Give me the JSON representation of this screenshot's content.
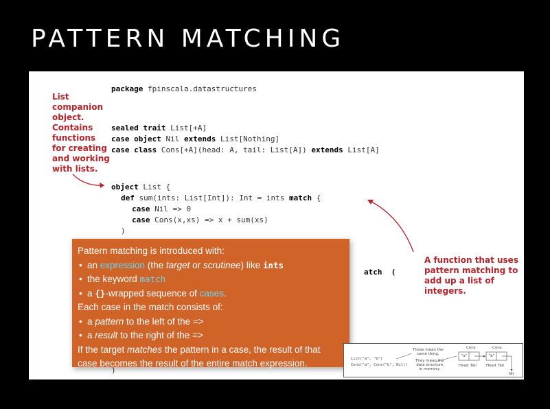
{
  "slide": {
    "title": "PATTERN MATCHING"
  },
  "code": {
    "package_kw": "package",
    "package_name": " fpinscala.datastructures",
    "sealed_kw": "sealed trait",
    "sealed_rest": " List[+A]",
    "case_object_kw": "case object",
    "nil_mid": " Nil ",
    "extends_kw": "extends",
    "nil_rest": " List[Nothing]",
    "case_class_kw": "case class",
    "cons_mid": " Cons[+A](head: A, tail: List[A]) ",
    "cons_rest": " List[A]",
    "object_kw": "object",
    "object_rest": " List {",
    "def_kw": "def",
    "def_mid": " sum(ints: List[Int]): Int = ints ",
    "match_kw": "match",
    "def_end": " {",
    "case_kw": "case",
    "case1_rest": " Nil => 0",
    "case2_rest": " Cons(x,xs) => x + sum(xs)",
    "close1": ")",
    "partial_match": "atch  (",
    "close2": ")"
  },
  "notes": {
    "companion": [
      "List",
      "companion",
      "object.",
      "Contains",
      "functions",
      "for creating",
      "and working",
      "with lists."
    ],
    "function_note": [
      "A function that uses",
      "pattern matching to",
      "add up a list of integers."
    ]
  },
  "callout": {
    "intro": "Pattern matching is introduced with:",
    "b1_a": "an ",
    "b1_expr": "expression",
    "b1_b": " (the ",
    "b1_target": "target",
    "b1_c": " or ",
    "b1_scrutinee": "scrutinee",
    "b1_d": ") like ",
    "b1_code": "ints",
    "b2_a": "the keyword ",
    "b2_code": "match",
    "b3_a": "a ",
    "b3_code": "{}",
    "b3_b": "-wrapped sequence of ",
    "b3_cases": "cases",
    "b3_c": ".",
    "each": "Each case in the match consists of:",
    "b4_a": "a ",
    "b4_pattern": "pattern",
    "b4_b": " to the left of the =>",
    "b5_a": "a ",
    "b5_result": "result",
    "b5_b": " to the right of the =>",
    "final1_a": "If the target ",
    "final1_matches": "matches",
    "final1_b": " the pattern in a case, the result of that",
    "final2": "case becomes the result of the entire match expression."
  },
  "diagram": {
    "code1": "List(\"a\", \"b\")",
    "code2": "Cons(\"a\", Cons(\"b\", Nil))",
    "note1": [
      "These mean the",
      "same thing."
    ],
    "note2": [
      "They mean the",
      "data structure",
      "in memory."
    ],
    "cons1": "Cons",
    "cons2": "Cons",
    "val_a": "\"a\"",
    "val_b": "\"b\"",
    "head1": "Head",
    "tail1": "Tail",
    "head2": "Head",
    "tail2": "Tail",
    "nil": "Nil"
  },
  "colors": {
    "accent_orange": "#cf6328",
    "note_red": "#b5242a",
    "keyword_cyan": "#6fd4ee"
  }
}
